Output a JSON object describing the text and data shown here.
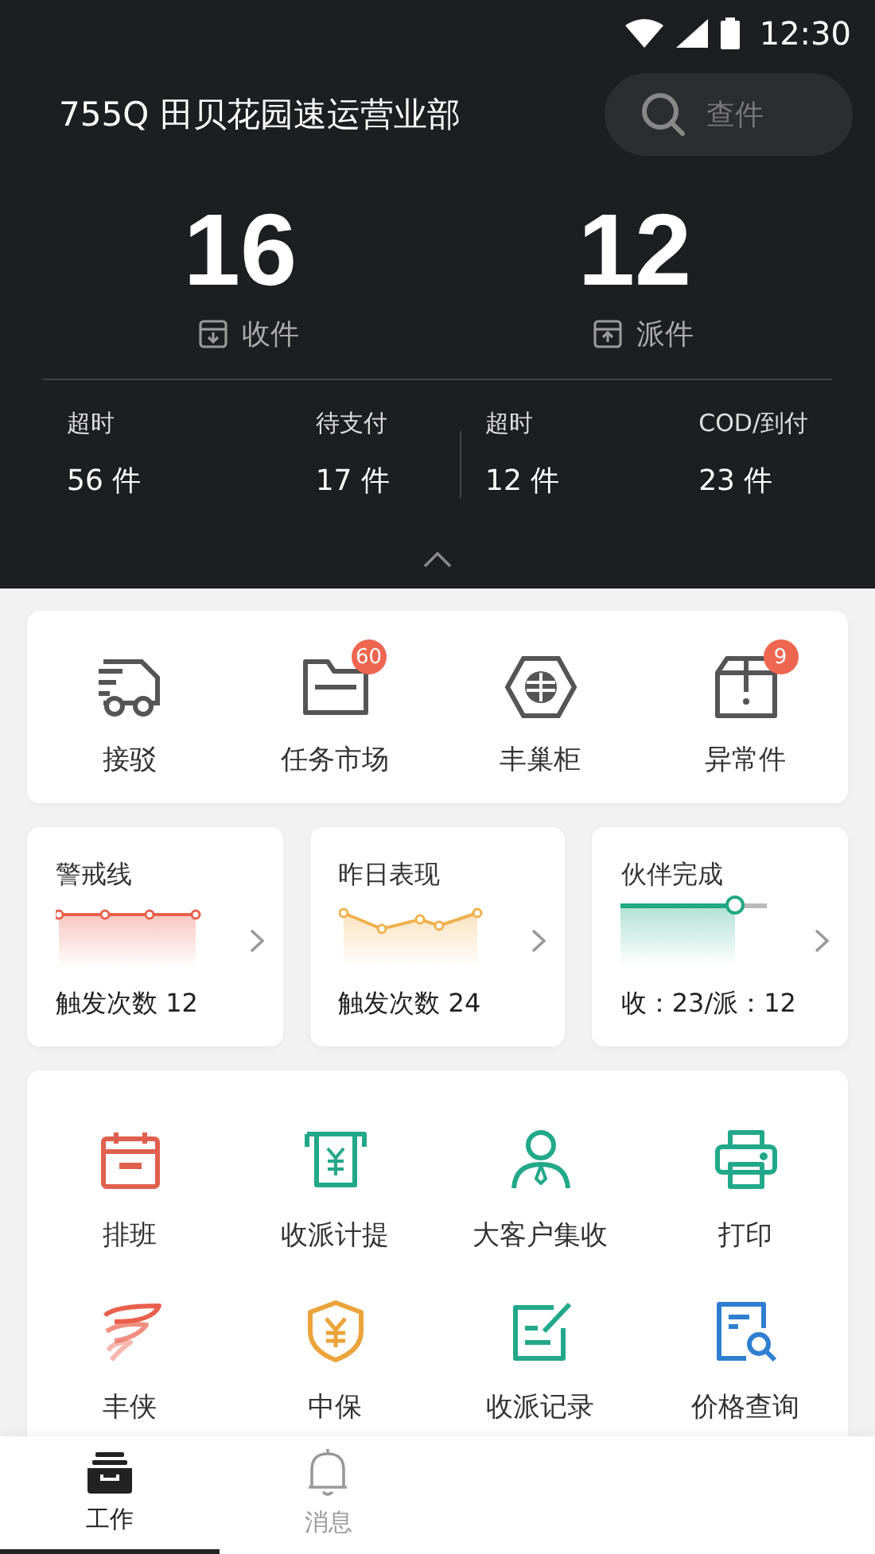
{
  "status_bar": {
    "time": "12:30"
  },
  "header": {
    "title": "755Q 田贝花园速运营业部",
    "search": {
      "placeholder": "查件"
    }
  },
  "totals": [
    {
      "value": "16",
      "label": "收件",
      "kind": "in"
    },
    {
      "value": "12",
      "label": "派件",
      "kind": "out"
    }
  ],
  "stats": [
    {
      "label": "超时",
      "value": "56 件"
    },
    {
      "label": "待支付",
      "value": "17 件"
    },
    {
      "label": "超时",
      "value": "12 件"
    },
    {
      "label": "COD/到付",
      "value": "23 件"
    }
  ],
  "quick_actions": [
    {
      "label": "接驳",
      "kind": "truck"
    },
    {
      "label": "任务市场",
      "kind": "folder",
      "badge": "60"
    },
    {
      "label": "丰巢柜",
      "kind": "locker"
    },
    {
      "label": "异常件",
      "kind": "box",
      "badge": "9"
    }
  ],
  "metric_cards": [
    {
      "title": "警戒线",
      "footer": "触发次数 12",
      "kind": "flat",
      "color": "#e8604c"
    },
    {
      "title": "昨日表现",
      "footer": "触发次数 24",
      "kind": "wave",
      "color": "#f0b04c"
    },
    {
      "title": "伙伴完成",
      "footer": "收：23/派：12",
      "kind": "progress",
      "color": "#1fa882",
      "level": 0.78
    }
  ],
  "tools": [
    {
      "label": "排班",
      "kind": "calendar",
      "color": "#e0604e"
    },
    {
      "label": "收派计提",
      "kind": "atm",
      "color": "#22a88a"
    },
    {
      "label": "大客户集收",
      "kind": "person",
      "color": "#22a88a"
    },
    {
      "label": "打印",
      "kind": "printer",
      "color": "#22a88a"
    },
    {
      "label": "丰侠",
      "kind": "wings",
      "color": "#e8604c"
    },
    {
      "label": "中保",
      "kind": "shield",
      "color": "#eba43a"
    },
    {
      "label": "收派记录",
      "kind": "note",
      "color": "#22a88a"
    },
    {
      "label": "价格查询",
      "kind": "doc-search",
      "color": "#2e7fd0"
    }
  ],
  "nav": [
    {
      "label": "工作",
      "kind": "tray",
      "selected": true
    },
    {
      "label": "消息",
      "kind": "bell",
      "selected": false
    }
  ]
}
